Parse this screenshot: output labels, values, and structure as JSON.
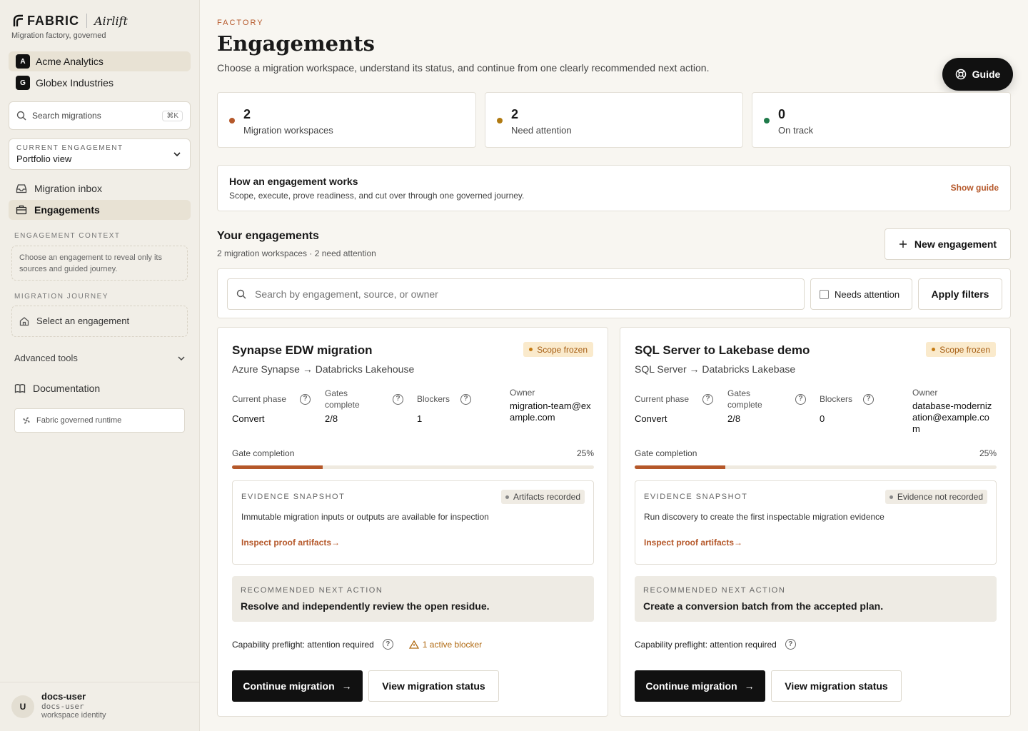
{
  "brand": {
    "logo": "FABRIC",
    "product": "Airlift",
    "tagline": "Migration factory, governed"
  },
  "workspaces": [
    {
      "badge": "A",
      "name": "Acme Analytics"
    },
    {
      "badge": "G",
      "name": "Globex Industries"
    }
  ],
  "search": {
    "placeholder": "Search migrations",
    "shortcut": "⌘K"
  },
  "current_engagement": {
    "label": "CURRENT ENGAGEMENT",
    "value": "Portfolio view"
  },
  "nav": [
    {
      "label": "Migration inbox"
    },
    {
      "label": "Engagements"
    }
  ],
  "engagement_context": {
    "label": "ENGAGEMENT CONTEXT",
    "text": "Choose an engagement to reveal only its sources and guided journey."
  },
  "migration_journey": {
    "label": "MIGRATION JOURNEY",
    "text": "Select an engagement"
  },
  "advanced_tools": "Advanced tools",
  "documentation": "Documentation",
  "runtime": "Fabric governed runtime",
  "user": {
    "avatar": "U",
    "name": "docs-user",
    "handle": "docs-user",
    "role": "workspace identity"
  },
  "header": {
    "eyebrow": "FACTORY",
    "title": "Engagements",
    "subtitle": "Choose a migration workspace, understand its status, and continue from one clearly recommended next action.",
    "guide": "Guide"
  },
  "stats": [
    {
      "value": "2",
      "label": "Migration workspaces",
      "color": "#b5582a"
    },
    {
      "value": "2",
      "label": "Need attention",
      "color": "#b07a12"
    },
    {
      "value": "0",
      "label": "On track",
      "color": "#1f7a4a"
    }
  ],
  "howto": {
    "title": "How an engagement works",
    "desc": "Scope, execute, prove readiness, and cut over through one governed journey.",
    "link": "Show guide"
  },
  "your_engagements": {
    "title": "Your engagements",
    "summary": "2 migration workspaces · 2 need attention",
    "new_button": "New engagement"
  },
  "filters": {
    "placeholder": "Search by engagement, source, or owner",
    "checkbox": "Needs attention",
    "apply": "Apply filters"
  },
  "labels": {
    "phase": "Current phase",
    "gates": "Gates complete",
    "blockers": "Blockers",
    "owner": "Owner",
    "gate_completion": "Gate completion",
    "evidence": "EVIDENCE SNAPSHOT",
    "inspect": "Inspect proof artifacts",
    "recommended": "RECOMMENDED NEXT ACTION",
    "continue": "Continue migration",
    "view": "View migration status"
  },
  "engagements": [
    {
      "title": "Synapse EDW migration",
      "source": "Azure Synapse",
      "target": "Databricks Lakehouse",
      "status": "Scope frozen",
      "phase": "Convert",
      "gates": "2/8",
      "blockers": "1",
      "owner": "migration-team@example.com",
      "gate_pct_label": "25%",
      "gate_pct": 25,
      "evidence_tag": "Artifacts recorded",
      "evidence_desc": "Immutable migration inputs or outputs are available for inspection",
      "next_action": "Resolve and independently review the open residue.",
      "preflight": "Capability preflight: attention required",
      "blocker_note": "1 active blocker"
    },
    {
      "title": "SQL Server to Lakebase demo",
      "source": "SQL Server",
      "target": "Databricks Lakebase",
      "status": "Scope frozen",
      "phase": "Convert",
      "gates": "2/8",
      "blockers": "0",
      "owner": "database-modernization@example.com",
      "gate_pct_label": "25%",
      "gate_pct": 25,
      "evidence_tag": "Evidence not recorded",
      "evidence_desc": "Run discovery to create the first inspectable migration evidence",
      "next_action": "Create a conversion batch from the accepted plan.",
      "preflight": "Capability preflight: attention required",
      "blocker_note": ""
    }
  ]
}
